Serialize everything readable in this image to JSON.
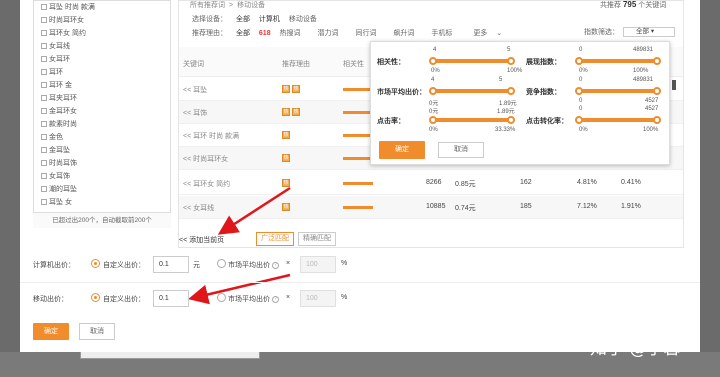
{
  "keywords": [
    "耳坠 时尚 款满",
    "时尚耳环女",
    "耳环女 简约",
    "女耳线",
    "女耳环",
    "耳环",
    "耳环 金",
    "耳夹耳环",
    "金耳环女",
    "款素时尚",
    "金色",
    "金耳坠",
    "时尚耳饰",
    "女耳饰",
    "潮的耳坠",
    "耳坠 女"
  ],
  "keyword_footer": "已超过出200个，自动截取前200个",
  "breadcrumb": [
    "所有推荐词",
    "移动设备"
  ],
  "total": {
    "prefix": "共推荐",
    "count": "795",
    "suffix": "个关键词"
  },
  "filters": {
    "device_label": "选择设备：",
    "devices": [
      "全部",
      "计算机",
      "移动设备"
    ],
    "reason_label": "推荐理由：",
    "reasons": [
      "全部",
      "618",
      "热搜词",
      "潜力词",
      "同行词",
      "飙升词",
      "手机标"
    ],
    "more": "更多",
    "index_filter_label": "指数筛选：",
    "index_filter_value": "全部"
  },
  "table": {
    "headers": [
      "关键词",
      "推荐理由",
      "相关性",
      "展现指数",
      "市场平均出价",
      "竞争指数",
      "点击率",
      "点击转化率"
    ],
    "rows": [
      {
        "keyword": "<< 耳坠",
        "icons": [
          "热",
          "热"
        ],
        "shows": "",
        "price": "",
        "comp": "",
        "ctr": "",
        "cvr": ""
      },
      {
        "keyword": "<< 耳饰",
        "icons": [
          "热",
          "热"
        ],
        "shows": "",
        "price": "",
        "comp": "",
        "ctr": "",
        "cvr": ""
      },
      {
        "keyword": "<< 耳环 时尚 款满",
        "icons": [
          "热"
        ],
        "shows": "",
        "price": "",
        "comp": "",
        "ctr": "",
        "cvr": ""
      },
      {
        "keyword": "<< 时尚耳环女",
        "icons": [
          "热"
        ],
        "shows": "",
        "price": "",
        "comp": "",
        "ctr": "",
        "cvr": ""
      },
      {
        "keyword": "<< 耳环女 简约",
        "icons": [
          "热"
        ],
        "shows": "8266",
        "price": "0.85元",
        "comp": "162",
        "ctr": "4.81%",
        "cvr": "0.41%"
      },
      {
        "keyword": "<< 女耳线",
        "icons": [
          "热"
        ],
        "shows": "10885",
        "price": "0.74元",
        "comp": "185",
        "ctr": "7.12%",
        "cvr": "1.91%"
      }
    ]
  },
  "popup": {
    "sliders": [
      {
        "label": "相关性：",
        "min": "4",
        "max": "5",
        "low": "0%",
        "high": "100%",
        "lo_frac": 0.0,
        "hi_frac": 1.0
      },
      {
        "label": "展现指数：",
        "min": "0",
        "max": "489831",
        "low": "0%",
        "high": "100%",
        "lo_frac": 0.0,
        "hi_frac": 1.0
      },
      {
        "label": "市场平均出价：",
        "min": "4",
        "max": "5",
        "low": "0元",
        "high": "1.89元",
        "lo_frac": 0.0,
        "hi_frac": 1.0
      },
      {
        "label": "竞争指数：",
        "min": "0",
        "max": "489831",
        "low": "0",
        "high": "4527",
        "lo_frac": 0.0,
        "hi_frac": 1.0
      },
      {
        "label": "点击率：",
        "min": "0元",
        "max": "1.89元",
        "low": "0%",
        "high": "33.33%",
        "lo_frac": 0.0,
        "hi_frac": 1.0
      },
      {
        "label": "点击转化率：",
        "min": "0",
        "max": "4527",
        "low": "0%",
        "high": "100%",
        "lo_frac": 0.0,
        "hi_frac": 1.0
      }
    ],
    "ok": "确定",
    "cancel": "取消"
  },
  "add_bar": {
    "add": "<< 添加当前页",
    "broad": "广泛匹配",
    "exact": "精确匹配"
  },
  "bids": {
    "pc_label": "计算机出价：",
    "mobile_label": "移动出价：",
    "custom": "自定义出价：",
    "pc_value": "0.1",
    "pc_unit": "元",
    "mobile_value": "0.1",
    "market": "市场平均出价",
    "mult": "×",
    "pct_placeholder": "100",
    "pct": "%"
  },
  "footer": {
    "ok": "确定",
    "cancel": "取消"
  },
  "watermark": "知乎 @子馨"
}
